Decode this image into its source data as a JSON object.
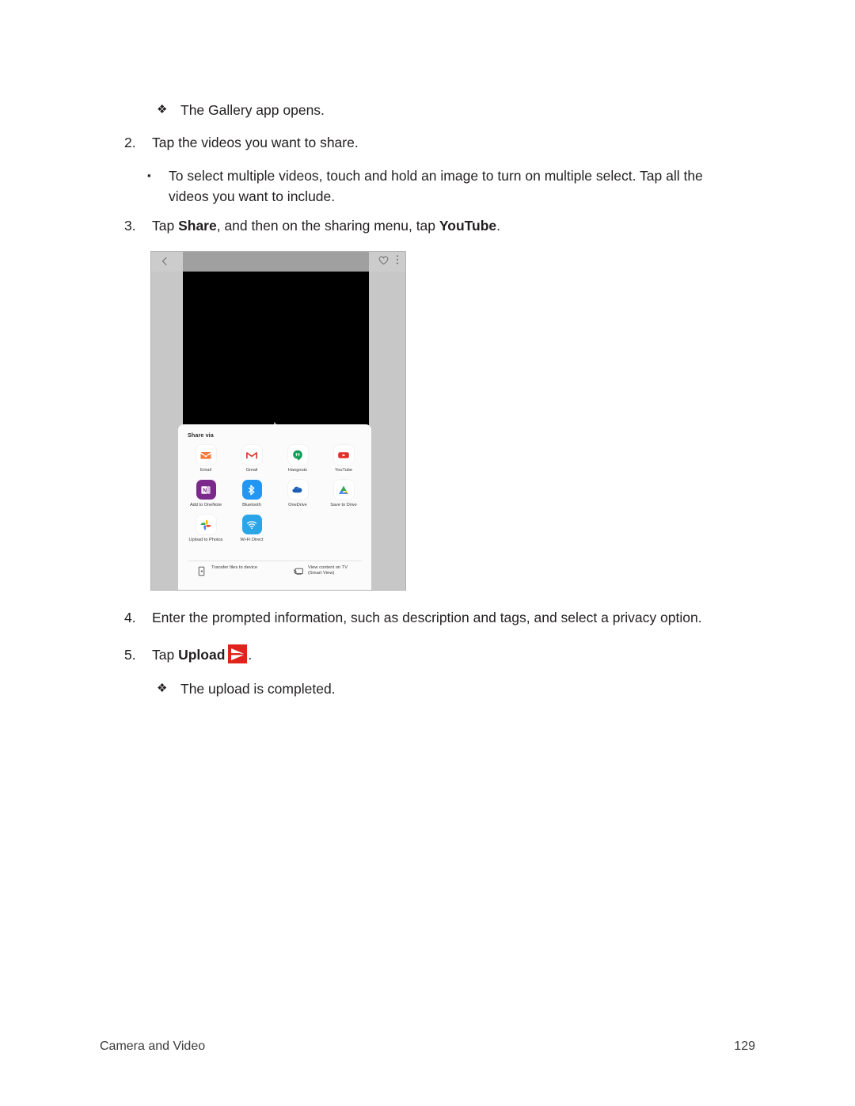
{
  "document": {
    "footer_left": "Camera and Video",
    "footer_page": "129"
  },
  "steps": {
    "gallery_opens": {
      "bullet": "❖",
      "text": "The Gallery app opens."
    },
    "step2": {
      "marker": "2.",
      "text": "Tap the videos you want to share."
    },
    "step2_sub": {
      "bullet": "▪",
      "text": "To select multiple videos, touch and hold an image to turn on multiple select. Tap all the videos you want to include."
    },
    "step3": {
      "marker": "3.",
      "text_pre": "Tap ",
      "bold1": "Share",
      "text_mid": ", and then on the sharing menu, tap ",
      "bold2": "YouTube",
      "text_post": "."
    },
    "step4": {
      "marker": "4.",
      "text": "Enter the prompted information, such as description and tags, and select a privacy option."
    },
    "step5": {
      "marker": "5.",
      "text_pre": "Tap ",
      "bold1": "Upload",
      "icon_name": "upload-icon",
      "text_post": "."
    },
    "upload_done": {
      "bullet": "❖",
      "text": "The upload is completed."
    }
  },
  "figure": {
    "name": "gallery-share-screenshot",
    "topbar": {
      "back_icon": "back-chevron-icon",
      "favorite_icon": "heart-icon",
      "overflow_icon": "more-vertical-icon"
    },
    "share_sheet": {
      "title": "Share via",
      "apps": [
        {
          "label": "Email",
          "icon": "email-icon"
        },
        {
          "label": "Gmail",
          "icon": "gmail-icon"
        },
        {
          "label": "Hangouts",
          "icon": "hangouts-icon"
        },
        {
          "label": "YouTube",
          "icon": "youtube-icon"
        },
        {
          "label": "Add to OneNote",
          "icon": "onenote-icon"
        },
        {
          "label": "Bluetooth",
          "icon": "bluetooth-icon"
        },
        {
          "label": "OneDrive",
          "icon": "onedrive-icon"
        },
        {
          "label": "Save to Drive",
          "icon": "google-drive-icon"
        },
        {
          "label": "Upload to Photos",
          "icon": "google-photos-icon"
        },
        {
          "label": "Wi-Fi Direct",
          "icon": "wifi-direct-icon"
        }
      ],
      "footer_actions": [
        {
          "label": "Transfer files to device",
          "icon": "transfer-files-icon"
        },
        {
          "label": "View content on TV\n(Smart View)",
          "icon": "smart-view-icon"
        }
      ]
    }
  },
  "colors": {
    "upload_red": "#e0231b",
    "youtube_red": "#e52d27",
    "hangouts_green": "#0f9d58",
    "bluetooth_blue": "#2196f3",
    "onenote_purple": "#7b2a8c",
    "onedrive_blue": "#1a5fb4",
    "email_orange": "#f4793c",
    "gmail_red": "#d93025",
    "text": "#231f20"
  }
}
